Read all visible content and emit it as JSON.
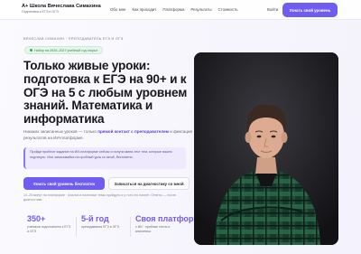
{
  "header": {
    "brand_title": "А+ Школа Вячеслава Симахина",
    "brand_subtitle": "Подготовка к ЕГЭ и ОГЭ",
    "nav": [
      "Обо мне",
      "Как проходит",
      "Платформа",
      "Результаты",
      "Стоимость"
    ],
    "login": "Войти",
    "cta": "Узнать свой уровень"
  },
  "hero": {
    "eyebrow": "ВЯЧЕСЛАВ СИМАХИН · ПРЕПОДАВАТЕЛЬ ЕГЭ И ОГЭ",
    "badge": "Набор на 2026–2027 учебный год открыт",
    "headline": "Только живые уроки: подготовка к ЕГЭ на 90+ и к ОГЭ на 5 с любым уровнем знаний. Математика и информатика",
    "sub_prefix": "Никаких записанных уроков — только ",
    "sub_highlight": "прямой контакт с преподавателем",
    "sub_suffix": " и фиксация результатов на ИИ-платформе.",
    "info": "Пройди пробное задание на ИИ-платформе сейчас и получи мини-тест тем, которые важно подтянуть. Или записывайся на пробный урок со мной, бесплатно.",
    "cta_primary": "Узнать свой уровень бесплатно",
    "cta_secondary": "Записаться на диагностику со мной",
    "note": "10–25 минут на платформе · Анализ и полезные темы прийдуть и у того кто начнёт. Ответы — после диагностики."
  },
  "stats": [
    {
      "value": "350+",
      "caption": "учеников подготовлено к ЕГЭ и ОГЭ"
    },
    {
      "value": "5-й год",
      "caption": "преподавания ЕГЭ и ОГЭ"
    },
    {
      "value": "Своя платформа",
      "caption": "с ИИ · пробные тесты и аналитика"
    }
  ],
  "colors": {
    "accent": "#6f5cf0",
    "badge_green": "#2fb256",
    "info_bg": "#eee9fd"
  }
}
